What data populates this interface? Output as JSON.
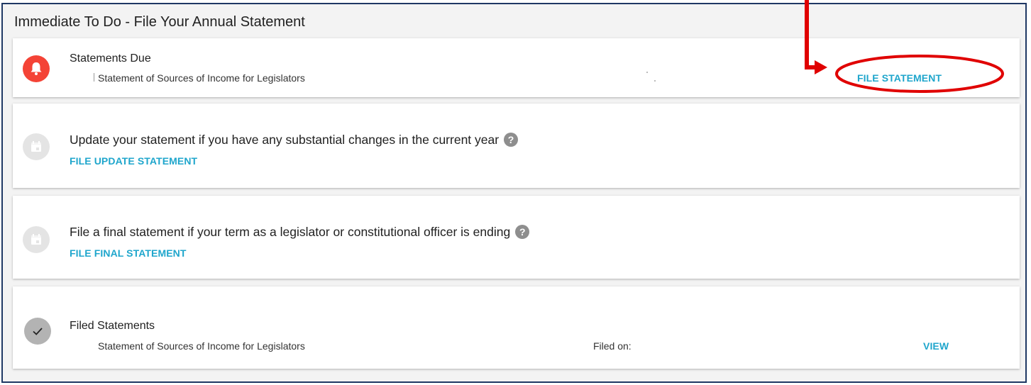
{
  "panel": {
    "title": "Immediate To Do - File Your Annual Statement"
  },
  "statements_due": {
    "title": "Statements Due",
    "item": "Statement of Sources of Income for Legislators",
    "action": "FILE STATEMENT",
    "icon": "bell-icon"
  },
  "update_statement": {
    "text": "Update your statement if you have any substantial changes in the current year",
    "help": "?",
    "action": "FILE UPDATE STATEMENT",
    "icon": "calendar-icon"
  },
  "final_statement": {
    "text": "File a final statement if your term as a legislator or constitutional officer is ending",
    "help": "?",
    "action": "FILE FINAL STATEMENT",
    "icon": "calendar-icon"
  },
  "filed_statements": {
    "title": "Filed Statements",
    "item": "Statement of Sources of Income for Legislators",
    "filed_on_label": "Filed on:",
    "action": "VIEW",
    "icon": "check-icon"
  },
  "colors": {
    "link": "#1fa6cc",
    "alert": "#f44336",
    "annotation": "#e00000",
    "frame_border": "#1f3864"
  }
}
